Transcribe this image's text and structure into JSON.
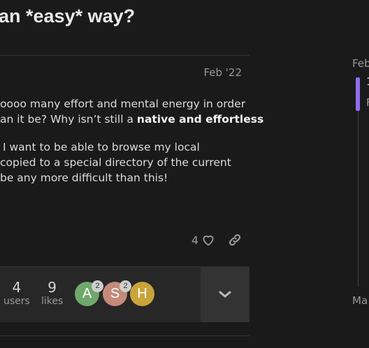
{
  "topic": {
    "title": "an *easy* way?"
  },
  "post": {
    "date": "Feb '22",
    "para1_line1": "oooo many effort and mental energy in order",
    "para1_line2_pre": "an it be? Why isn’t still a ",
    "para1_line2_bold": "native and effortless",
    "para2_line1": "I want to be able to browse my local",
    "para2_line2": "copied to a special directory of the current",
    "para2_line3": "be any more difficult than this!",
    "like_count": "4",
    "icons": {
      "like": "heart-icon",
      "share": "link-icon"
    }
  },
  "topic_map": {
    "users_count": "4",
    "users_label": "users",
    "likes_count": "9",
    "likes_label": "likes",
    "participants": [
      {
        "letter": "A",
        "color": "#6fa86a",
        "count": "2"
      },
      {
        "letter": "S",
        "color": "#c48a7a",
        "count": "2"
      },
      {
        "letter": "H",
        "color": "#c9a43a"
      }
    ],
    "expand_icon": "chevron-down-icon"
  },
  "timeline": {
    "start_label": "Feb",
    "current_num": "1",
    "current_date": "F",
    "end_label": "Ma",
    "accent": "#8e6cf0"
  }
}
